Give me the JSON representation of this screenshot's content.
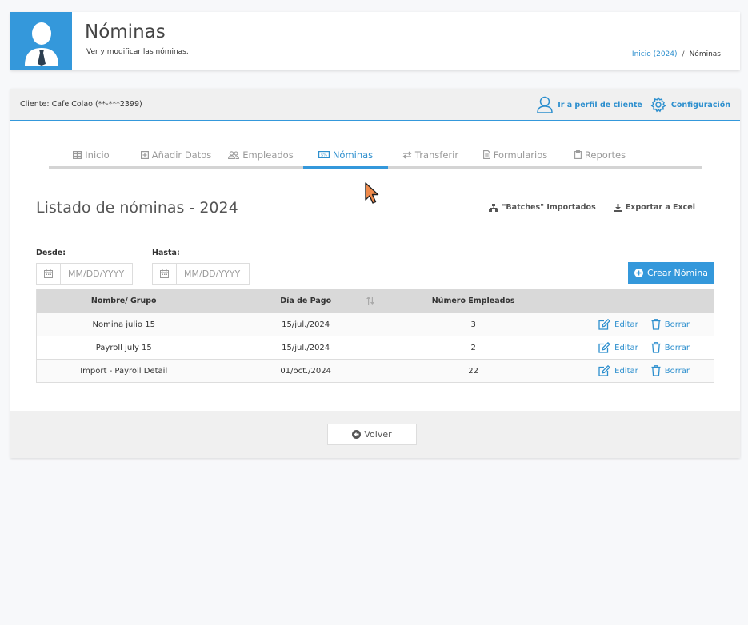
{
  "header": {
    "title": "Nóminas",
    "subtitle": "Ver y modificar las nóminas.",
    "breadcrumb": {
      "home": "Inicio (2024)",
      "separator": "/",
      "current": "Nóminas"
    },
    "accent": "#3498db"
  },
  "client_bar": {
    "client_label": "Cliente: Cafe Colao (**-***2399)",
    "profile_link": "Ir a perfil de cliente",
    "settings_link": "Configuración"
  },
  "tabs": [
    {
      "label": "Inicio",
      "icon": "table-icon"
    },
    {
      "label": "Añadir Datos",
      "icon": "plus-square-icon"
    },
    {
      "label": "Empleados",
      "icon": "users-icon"
    },
    {
      "label": "Nóminas",
      "icon": "money-bill-icon"
    },
    {
      "label": "Transferir",
      "icon": "exchange-icon"
    },
    {
      "label": "Formularios",
      "icon": "file-icon"
    },
    {
      "label": "Reportes",
      "icon": "clipboard-icon"
    }
  ],
  "active_tab": "Nóminas",
  "list": {
    "title": "Listado de nóminas - 2024",
    "batches_label": "\"Batches\" Importados",
    "export_label": "Exportar a Excel"
  },
  "filters": {
    "from_label": "Desde:",
    "to_label": "Hasta:",
    "date_placeholder": "MM/DD/YYYY"
  },
  "create_button": "Crear Nómina",
  "table": {
    "headers": [
      "Nombre/ Grupo",
      "Día de Pago",
      "Número Empleados"
    ],
    "rows": [
      {
        "name": "Nomina julio 15",
        "date": "15/jul./2024",
        "employees": "3"
      },
      {
        "name": "Payroll july 15",
        "date": "15/jul./2024",
        "employees": "2"
      },
      {
        "name": "Import - Payroll Detail",
        "date": "01/oct./2024",
        "employees": "22"
      }
    ],
    "edit_label": "Editar",
    "delete_label": "Borrar"
  },
  "back_button": "Volver"
}
